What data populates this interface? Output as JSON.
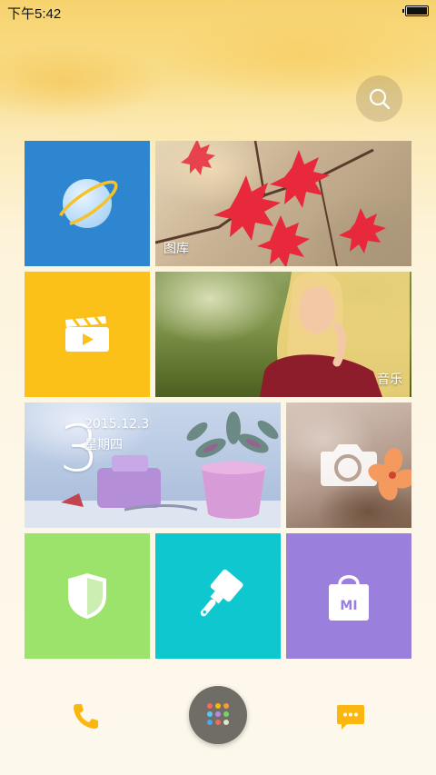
{
  "status_bar": {
    "time": "下午5:42"
  },
  "tiles": {
    "browser": {
      "icon": "planet-icon"
    },
    "gallery": {
      "label": "图库"
    },
    "video": {
      "icon": "clapperboard-icon"
    },
    "music": {
      "label": "音乐"
    },
    "clock": {
      "day": "3",
      "date": "2015.12.3",
      "weekday": "星期四"
    },
    "camera": {
      "icon": "camera-icon"
    },
    "security": {
      "icon": "shield-icon"
    },
    "theme": {
      "icon": "paintbrush-icon"
    },
    "store": {
      "icon": "shopping-bag-icon",
      "bag_text": "MI"
    }
  },
  "dock": {
    "phone_icon": "phone-icon",
    "apps_icon": "app-drawer-icon",
    "messages_icon": "message-icon"
  },
  "colors": {
    "browser": "#2e86d0",
    "video": "#fcc118",
    "security": "#9be36a",
    "theme": "#0fc7cf",
    "store": "#9a7fdd",
    "dock_accent": "#fbb70f"
  }
}
